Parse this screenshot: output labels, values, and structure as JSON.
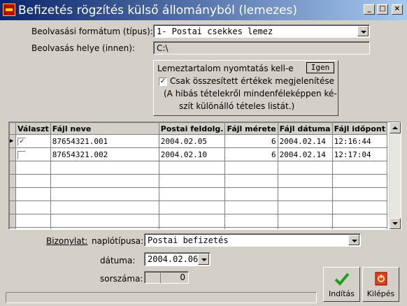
{
  "window": {
    "title": "Befizetés rögzítés külső állományból (lemezes)",
    "btn_min": "_",
    "btn_max": "□",
    "btn_close": "×"
  },
  "format": {
    "label": "Beolvasási formátum (típus):",
    "value": "1- Postai csekkes lemez"
  },
  "location": {
    "label": "Beolvasás helye (innen):",
    "value": "C:\\"
  },
  "print": {
    "label": "Lemeztartalom nyomtatás kell-e",
    "value": "Igen",
    "summary_label": "Csak összesített értékek megjelenítése",
    "summary_checked": "✓",
    "note_line1": "(A hibás tételekről mindenféleképpen ké-",
    "note_line2": "szít különálló tételes listát.)"
  },
  "grid": {
    "columns": [
      "Választ",
      "Fájl neve",
      "Postai feldolg.",
      "Fájl mérete",
      "Fájl dátuma",
      "Fájl időpont"
    ],
    "rows": [
      {
        "marker": "▶",
        "check": "✓",
        "name": "87654321.001",
        "postal": "2004.02.05",
        "size": "6",
        "date": "2004.02.14",
        "time": "12:16:44"
      },
      {
        "marker": "",
        "check": "",
        "name": "87654321.002",
        "postal": "2004.02.10",
        "size": "6",
        "date": "2004.02.14",
        "time": "12:17:04"
      }
    ]
  },
  "document": {
    "label": "Bizonylat:",
    "type_label": "naplótípusa:",
    "type_value": "Postai befizetés",
    "date_label": "dátuma:",
    "date_value": "2004.02.06",
    "number_label": "sorszáma:",
    "number_value": "0"
  },
  "actions": {
    "start_label": "Indítás",
    "exit_label": "Kilépés"
  },
  "colors": {
    "title_start": "#0a246a",
    "title_end": "#a6caf0",
    "face": "#d4d0c8",
    "ok_green": "#1e9e1e",
    "exit_red": "#e04020"
  }
}
